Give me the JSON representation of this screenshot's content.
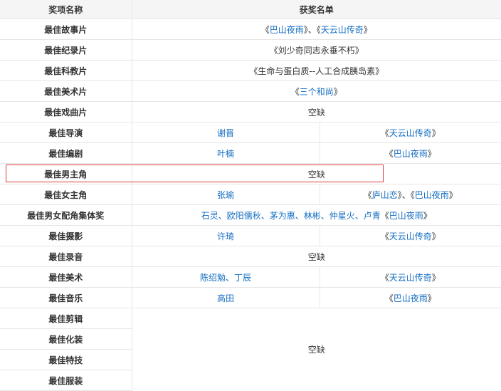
{
  "header": {
    "award": "奖项名称",
    "winners": "获奖名单"
  },
  "highlight_color": "#e0393e",
  "link_color": "#136ec2",
  "rows": [
    {
      "award": "最佳故事片",
      "full": [
        {
          "t": "《",
          "l": false
        },
        {
          "t": "巴山夜雨",
          "l": true
        },
        {
          "t": "》、《",
          "l": false
        },
        {
          "t": "天云山传奇",
          "l": true
        },
        {
          "t": "》",
          "l": false
        }
      ]
    },
    {
      "award": "最佳纪录片",
      "full": [
        {
          "t": "《刘少奇同志永垂不朽》",
          "l": false
        }
      ]
    },
    {
      "award": "最佳科教片",
      "full": [
        {
          "t": "《生命与蛋白质--人工合成胰岛素》",
          "l": false
        }
      ]
    },
    {
      "award": "最佳美术片",
      "full": [
        {
          "t": "《",
          "l": false
        },
        {
          "t": "三个和尚",
          "l": true
        },
        {
          "t": "》",
          "l": false
        }
      ]
    },
    {
      "award": "最佳戏曲片",
      "full": [
        {
          "t": "空缺",
          "l": false
        }
      ]
    },
    {
      "award": "最佳导演",
      "person": [
        {
          "t": "谢晋",
          "l": true
        }
      ],
      "film": [
        {
          "t": "《",
          "l": false
        },
        {
          "t": "天云山传奇",
          "l": true
        },
        {
          "t": "》",
          "l": false
        }
      ]
    },
    {
      "award": "最佳编剧",
      "person": [
        {
          "t": "叶楠",
          "l": true
        }
      ],
      "film": [
        {
          "t": "《",
          "l": false
        },
        {
          "t": "巴山夜雨",
          "l": true
        },
        {
          "t": "》",
          "l": false
        }
      ]
    },
    {
      "award": "最佳男主角",
      "full": [
        {
          "t": "空缺",
          "l": false
        }
      ]
    },
    {
      "award": "最佳女主角",
      "person": [
        {
          "t": "张瑜",
          "l": true
        }
      ],
      "film": [
        {
          "t": "《",
          "l": false
        },
        {
          "t": "庐山恋",
          "l": true
        },
        {
          "t": "》、《",
          "l": false
        },
        {
          "t": "巴山夜雨",
          "l": true
        },
        {
          "t": "》",
          "l": false
        }
      ]
    },
    {
      "award": "最佳男女配角集体奖",
      "full": [
        {
          "t": "石灵、欧阳儒秋、茅为惠、林彬、仲星火、卢青",
          "l": true
        },
        {
          "t": "《",
          "l": false
        },
        {
          "t": "巴山夜雨",
          "l": true
        },
        {
          "t": "》",
          "l": false
        }
      ]
    },
    {
      "award": "最佳摄影",
      "person": [
        {
          "t": "许琦",
          "l": true
        }
      ],
      "film": [
        {
          "t": "《",
          "l": false
        },
        {
          "t": "天云山传奇",
          "l": true
        },
        {
          "t": "》",
          "l": false
        }
      ]
    },
    {
      "award": "最佳录音",
      "full": [
        {
          "t": "空缺",
          "l": false
        }
      ]
    },
    {
      "award": "最佳美术",
      "person": [
        {
          "t": "陈绍勉、丁辰",
          "l": true
        }
      ],
      "film": [
        {
          "t": "《",
          "l": false
        },
        {
          "t": "天云山传奇",
          "l": true
        },
        {
          "t": "》",
          "l": false
        }
      ]
    },
    {
      "award": "最佳音乐",
      "person": [
        {
          "t": "高田",
          "l": true
        }
      ],
      "film": [
        {
          "t": "《",
          "l": false
        },
        {
          "t": "巴山夜雨",
          "l": true
        },
        {
          "t": "》",
          "l": false
        }
      ]
    }
  ],
  "merged_group": {
    "awards": [
      "最佳剪辑",
      "最佳化装",
      "最佳特技",
      "最佳服装"
    ],
    "value": "空缺"
  }
}
